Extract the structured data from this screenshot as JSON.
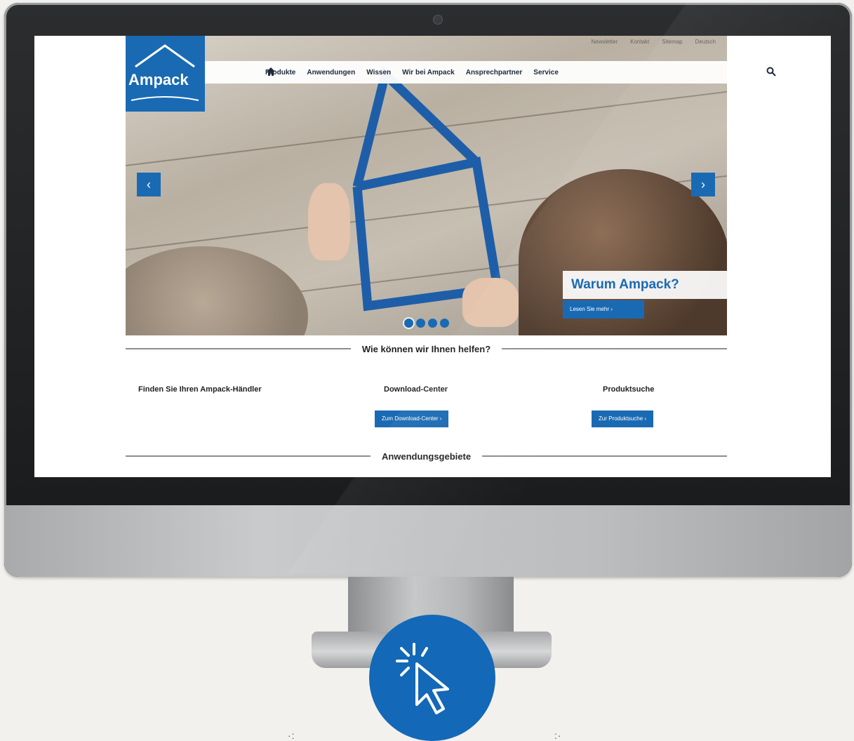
{
  "site": {
    "brand": "Ampack",
    "top_links": [
      "Newsletter",
      "Kontakt",
      "Sitemap",
      "Deutsch"
    ],
    "nav": [
      "Produkte",
      "Anwendungen",
      "Wissen",
      "Wir bei Ampack",
      "Ansprechpartner",
      "Service"
    ],
    "hero": {
      "teaser_title": "Warum Ampack?",
      "teaser_button": "Lesen Sie mehr ›",
      "slide_count": 4,
      "active_slide": 1,
      "prev_arrow": "‹",
      "next_arrow": "›"
    },
    "help_heading": "Wie können wir Ihnen helfen?",
    "columns": [
      {
        "label": "Finden Sie Ihren Ampack-Händler"
      },
      {
        "label": "Download-Center",
        "button": "Zum Download-Center ›"
      },
      {
        "label": "Produktsuche",
        "button": "Zur Produktsuche ›"
      }
    ],
    "applications_heading": "Anwendungsgebiete"
  },
  "colors": {
    "brand_blue": "#1a6ab3",
    "background": "#f3f1ed"
  },
  "icons": [
    "home-icon",
    "search-icon",
    "camera-icon",
    "cursor-click-icon"
  ]
}
